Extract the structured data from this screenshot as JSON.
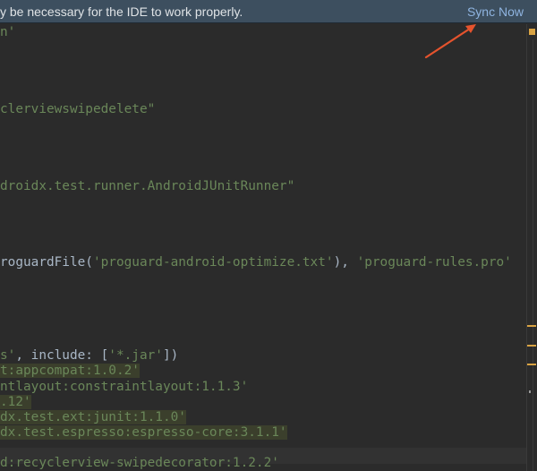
{
  "notification": {
    "message": "y be necessary for the IDE to work properly.",
    "action_label": "Sync Now"
  },
  "code_lines": [
    {
      "pre": "",
      "str": "n'",
      "post": ""
    },
    {
      "pre": "",
      "str": "clerviewswipedelete\"",
      "post": ""
    },
    {
      "pre": "",
      "str": "droidx.test.runner.AndroidJUnitRunner\"",
      "post": ""
    },
    {
      "pre": "roguardFile(",
      "str": "'proguard-android-optimize.txt'",
      "post": "), ",
      "str2": "'proguard-rules.pro'"
    },
    {
      "pre": "",
      "str": "s'",
      "post": ", include: [",
      "str2": "'*.jar'",
      "post2": "])"
    },
    {
      "pre": "",
      "str": "t:appcompat:1.0.2'",
      "post": ""
    },
    {
      "pre": "",
      "str": "ntlayout:constraintlayout:1.1.3'",
      "post": ""
    },
    {
      "pre": "",
      "str": ".12'",
      "post": ""
    },
    {
      "pre": "",
      "str": "dx.test.ext:junit:1.1.0'",
      "post": ""
    },
    {
      "pre": "",
      "str": "dx.test.espresso:espresso-core:3.1.1'",
      "post": ""
    },
    {
      "pre": "",
      "str": "d:recyclerview-swipedecorator:1.2.2'",
      "post": ""
    }
  ],
  "colors": {
    "banner_bg": "#3d4f5f",
    "link": "#8fb4e0",
    "editor_bg": "#2b2b2b",
    "string": "#6a8759",
    "plain": "#a9b7c6",
    "highlight_bg": "#3b3f2c",
    "arrow": "#e5532d",
    "warning": "#d9a343"
  },
  "icons": [
    "arrow-annotation",
    "warning-status-icon"
  ]
}
